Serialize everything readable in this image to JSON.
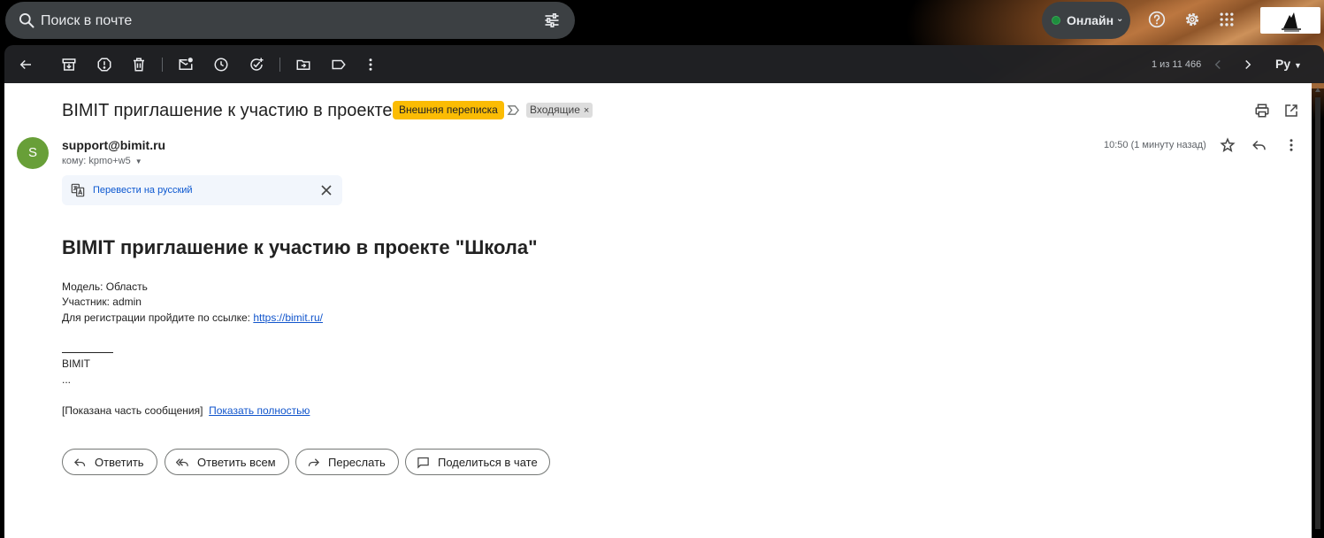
{
  "search": {
    "placeholder": "Поиск в почте"
  },
  "status": {
    "label": "Онлайн",
    "color": "#34a853"
  },
  "toolbar": {
    "counter": "1 из 11 466",
    "lang": "Ру"
  },
  "email": {
    "subject": "BIMIT приглашение к участию в проекте",
    "labels": {
      "external": "Внешняя переписка",
      "inbox": "Входящие"
    },
    "sender": "support@bimit.ru",
    "avatar_letter": "S",
    "to": "кому: kpmo+w5",
    "time": "10:50 (1 минуту назад)",
    "translate": {
      "link": "Перевести на русский"
    },
    "body": {
      "heading": "BIMIT приглашение к участию в проекте \"Школа\"",
      "model": "Модель: Область",
      "participant": "Участник: admin",
      "register_prefix": "Для регистрации пройдите по ссылке: ",
      "register_link": "https://bimit.ru/",
      "signature": "BIMIT",
      "ellipsis": "...",
      "trimmed_note": "[Показана часть сообщения]",
      "show_full": "Показать полностью"
    },
    "actions": {
      "reply": "Ответить",
      "reply_all": "Ответить всем",
      "forward": "Переслать",
      "share_chat": "Поделиться в чате"
    }
  }
}
